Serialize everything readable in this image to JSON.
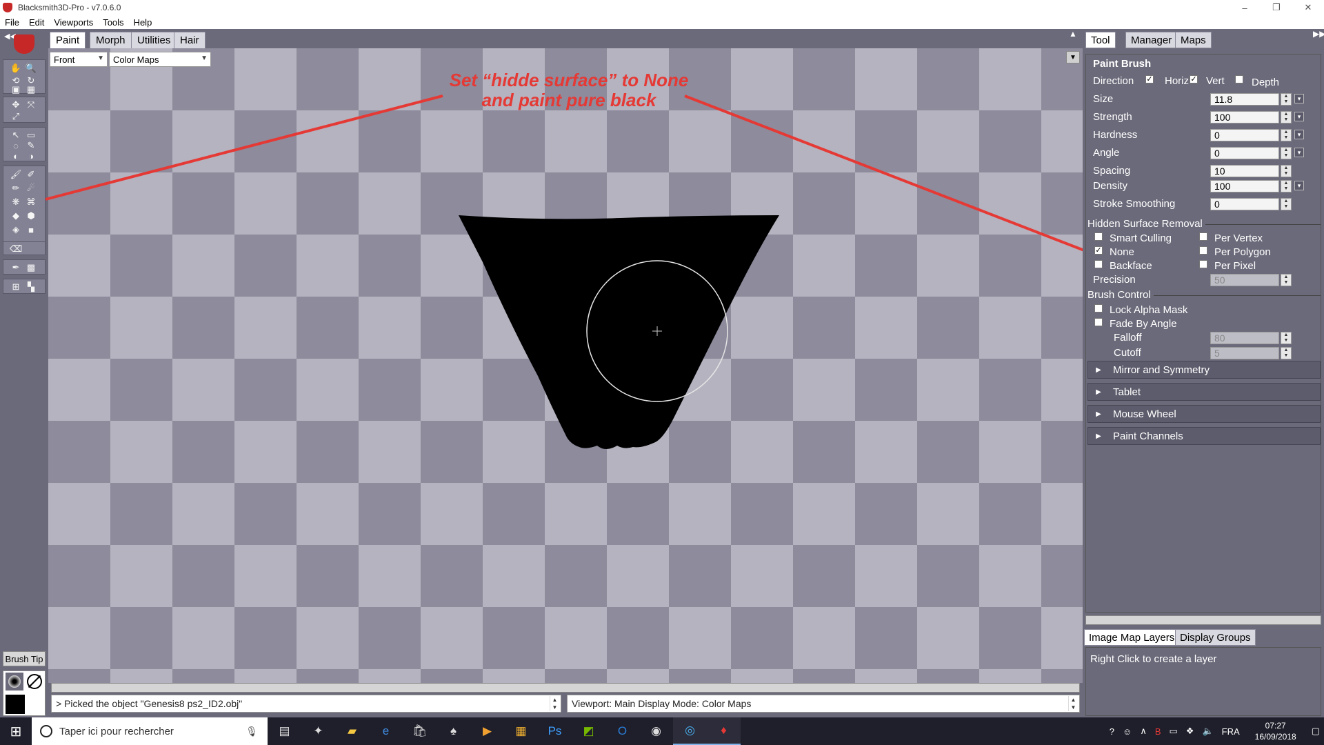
{
  "window": {
    "title": "Blacksmith3D-Pro - v7.0.6.0",
    "controls": [
      "–",
      "❐",
      "✕"
    ]
  },
  "menu": [
    "File",
    "Edit",
    "Viewports",
    "Tools",
    "Help"
  ],
  "mode_tabs": [
    "Paint",
    "Morph",
    "Utilities",
    "Hair"
  ],
  "viewport": {
    "view_select": "Front",
    "display_select": "Color Maps"
  },
  "annotation": {
    "line1": "Set “hidde surface” to None",
    "line2": "and paint pure black",
    "color": "#e53935"
  },
  "left_toolbar": {
    "brush_tip_label": "Brush Tip"
  },
  "status": {
    "log": "> Picked the object \"Genesis8 ps2_ID2.obj\"",
    "viewport_info": "Viewport: Main Display Mode: Color Maps"
  },
  "panel_tabs": [
    "Tool",
    "Manager",
    "Maps"
  ],
  "paint_brush": {
    "heading": "Paint Brush",
    "direction_label": "Direction",
    "direction": [
      {
        "label": "Horiz",
        "checked": true
      },
      {
        "label": "Vert",
        "checked": true
      },
      {
        "label": "Depth",
        "checked": false
      }
    ],
    "params": [
      {
        "label": "Size",
        "value": "11.8",
        "pick": true
      },
      {
        "label": "Strength",
        "value": "100",
        "pick": true
      },
      {
        "label": "Hardness",
        "value": "0",
        "pick": true
      },
      {
        "label": "Angle",
        "value": "0",
        "pick": true
      },
      {
        "label": "Spacing",
        "value": "10",
        "pick": false
      },
      {
        "label": "Density",
        "value": "100",
        "pick": true
      },
      {
        "label": "Stroke Smoothing",
        "value": "0",
        "pick": false
      }
    ]
  },
  "hidden_surface": {
    "title": "Hidden Surface Removal",
    "left": [
      {
        "label": "Smart Culling",
        "checked": false
      },
      {
        "label": "None",
        "checked": true
      },
      {
        "label": "Backface",
        "checked": false
      }
    ],
    "right": [
      {
        "label": "Per Vertex",
        "checked": false
      },
      {
        "label": "Per Polygon",
        "checked": false
      },
      {
        "label": "Per Pixel",
        "checked": false
      }
    ],
    "precision_label": "Precision",
    "precision_value": "50"
  },
  "brush_control": {
    "title": "Brush Control",
    "lock_alpha": {
      "label": "Lock Alpha Mask",
      "checked": false
    },
    "fade_angle": {
      "label": "Fade By Angle",
      "checked": false
    },
    "falloff_label": "Falloff",
    "falloff_value": "80",
    "cutoff_label": "Cutoff",
    "cutoff_value": "5"
  },
  "expanders": [
    "Mirror and Symmetry",
    "Tablet",
    "Mouse Wheel",
    "Paint Channels"
  ],
  "bottom_tabs": [
    "Image Map Layers",
    "Display Groups"
  ],
  "layers_hint": "Right Click to create a layer",
  "taskbar": {
    "search_placeholder": "Taper ici pour rechercher",
    "language": "FRA",
    "time": "07:27",
    "date": "16/09/2018"
  }
}
